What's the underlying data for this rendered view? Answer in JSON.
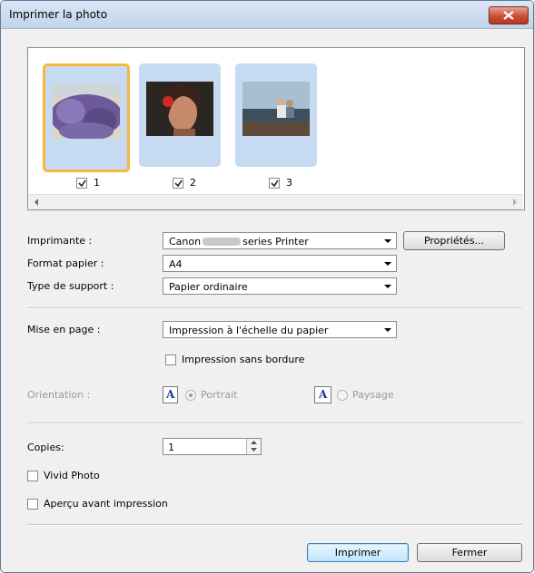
{
  "window": {
    "title": "Imprimer la photo"
  },
  "photos": [
    {
      "number": "1",
      "checked": true,
      "selected": true
    },
    {
      "number": "2",
      "checked": true,
      "selected": false
    },
    {
      "number": "3",
      "checked": true,
      "selected": false
    }
  ],
  "printer": {
    "label": "Imprimante :",
    "value_prefix": "Canon",
    "value_suffix": "series Printer",
    "properties_button": "Propriétés..."
  },
  "paper_size": {
    "label": "Format papier :",
    "value": "A4"
  },
  "media_type": {
    "label": "Type de support :",
    "value": "Papier ordinaire"
  },
  "layout": {
    "label": "Mise en page :",
    "value": "Impression à l'échelle du papier",
    "borderless_label": "Impression sans bordure",
    "borderless_checked": false
  },
  "orientation": {
    "label": "Orientation :",
    "portrait_label": "Portrait",
    "landscape_label": "Paysage",
    "selected": "Portrait"
  },
  "copies": {
    "label": "Copies:",
    "value": "1"
  },
  "vivid_photo": {
    "label": "Vivid Photo",
    "checked": false
  },
  "preview": {
    "label": "Aperçu avant impression",
    "checked": false
  },
  "buttons": {
    "print": "Imprimer",
    "close": "Fermer"
  }
}
